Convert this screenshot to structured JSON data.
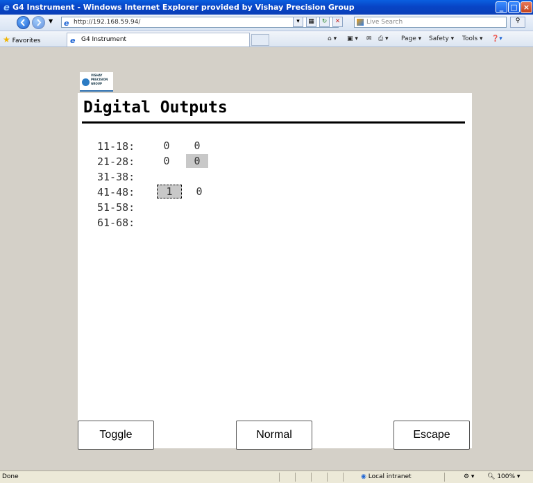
{
  "window": {
    "title": "G4 Instrument - Windows Internet Explorer provided by Vishay Precision Group",
    "minimize": "_",
    "maximize": "□",
    "close": "×"
  },
  "address": {
    "url": "http://192.168.59.94/",
    "search_placeholder": "Live Search"
  },
  "favorites": {
    "label": "Favorites",
    "tab_title": "G4 Instrument"
  },
  "commands": {
    "page": "Page ▾",
    "safety": "Safety ▾",
    "tools": "Tools ▾"
  },
  "logo": {
    "line1": "VISHAY",
    "line2": "PRECISION",
    "line3": "GROUP"
  },
  "page": {
    "title": "Digital Outputs",
    "rows": [
      {
        "label": "11-18:",
        "v1": "0",
        "v2": "0"
      },
      {
        "label": "21-28:",
        "v1": "0",
        "v2": "0"
      },
      {
        "label": "31-38:",
        "v1": "",
        "v2": ""
      },
      {
        "label": "41-48:",
        "v1": "1",
        "v2": "0"
      },
      {
        "label": "51-58:",
        "v1": "",
        "v2": ""
      },
      {
        "label": "61-68:",
        "v1": "",
        "v2": ""
      }
    ]
  },
  "buttons": {
    "toggle": "Toggle",
    "normal": "Normal",
    "escape": "Escape"
  },
  "status": {
    "text": "Done",
    "zone": "Local intranet",
    "zoom": "100%"
  }
}
